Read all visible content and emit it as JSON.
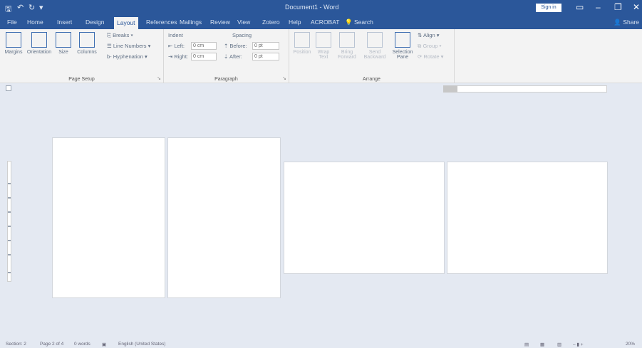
{
  "window": {
    "title": "Document1 - Word",
    "sign_in": "Sign in"
  },
  "quick_access": {
    "save_icon": "save-icon",
    "undo_icon": "undo-icon",
    "redo_icon": "redo-icon"
  },
  "tabs": [
    "File",
    "Home",
    "Insert",
    "Design",
    "Layout",
    "References",
    "Mailings",
    "Review",
    "View",
    "Zotero",
    "Help",
    "ACROBAT"
  ],
  "active_tab": "Layout",
  "search_placeholder": "Search",
  "share_label": "Share",
  "ribbon": {
    "page_setup": {
      "label": "Page Setup",
      "margins": "Margins",
      "orientation": "Orientation",
      "size": "Size",
      "columns": "Columns",
      "breaks": "Breaks",
      "line_numbers": "Line Numbers",
      "hyphenation": "Hyphenation"
    },
    "paragraph": {
      "label": "Paragraph",
      "indent": "Indent",
      "left_label": "Left:",
      "left_value": "0 cm",
      "right_label": "Right:",
      "right_value": "0 cm",
      "spacing": "Spacing",
      "before_label": "Before:",
      "before_value": "0 pt",
      "after_label": "After:",
      "after_value": "0 pt"
    },
    "arrange": {
      "label": "Arrange",
      "position": "Position",
      "wrap_text": "Wrap Text",
      "bring_forward": "Bring Forward",
      "send_backward": "Send Backward",
      "selection_pane": "Selection Pane",
      "align": "Align",
      "group": "Group",
      "rotate": "Rotate"
    }
  },
  "status": {
    "section": "Section: 2",
    "page": "Page 2 of 4",
    "words": "0 words",
    "language": "English (United States)",
    "zoom": "20%"
  },
  "colors": {
    "title_bar": "#2b579a",
    "ribbon": "#f3f3f3",
    "canvas": "#e4e9f2",
    "page": "#ffffff"
  }
}
